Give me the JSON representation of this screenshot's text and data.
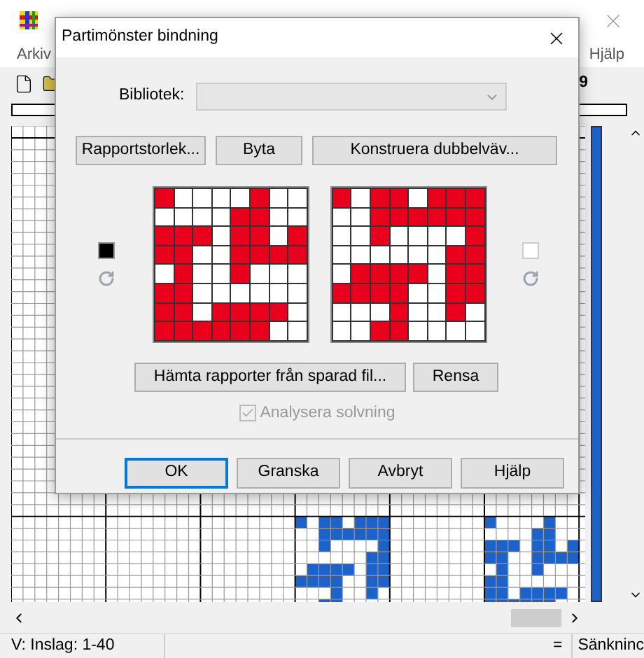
{
  "app": {
    "menu": [
      "Arkiv",
      "Hjälp"
    ],
    "toolbar_text": "9",
    "status_bar": [
      "V: Inslag: 1-40",
      "=",
      "Sänkninc"
    ]
  },
  "dialog": {
    "title": "Partimönster bindning",
    "library": {
      "label": "Bibliotek:",
      "disabled": true
    },
    "top_buttons": [
      "Rapportstorlek...",
      "Byta",
      "Konstruera dubbelväv..."
    ],
    "left_swatch": {
      "color": "#000000"
    },
    "right_swatch": {
      "color": "#ffffff"
    },
    "grids": [
      {
        "cells": [
          [
            true,
            false,
            false,
            false,
            false,
            true,
            false,
            false
          ],
          [
            false,
            false,
            false,
            false,
            true,
            true,
            false,
            false
          ],
          [
            true,
            true,
            true,
            false,
            true,
            true,
            false,
            true
          ],
          [
            true,
            true,
            false,
            false,
            true,
            true,
            true,
            true
          ],
          [
            false,
            true,
            false,
            false,
            true,
            false,
            false,
            false
          ],
          [
            true,
            true,
            false,
            false,
            false,
            false,
            false,
            false
          ],
          [
            true,
            true,
            false,
            true,
            true,
            true,
            true,
            false
          ],
          [
            true,
            true,
            true,
            true,
            true,
            true,
            false,
            false
          ]
        ]
      },
      {
        "cells": [
          [
            true,
            false,
            true,
            true,
            false,
            true,
            true,
            true
          ],
          [
            false,
            false,
            true,
            true,
            true,
            true,
            true,
            true
          ],
          [
            false,
            false,
            true,
            false,
            false,
            false,
            false,
            true
          ],
          [
            false,
            false,
            false,
            false,
            false,
            false,
            true,
            true
          ],
          [
            false,
            true,
            true,
            true,
            true,
            false,
            true,
            true
          ],
          [
            true,
            true,
            true,
            true,
            false,
            false,
            true,
            true
          ],
          [
            false,
            false,
            false,
            true,
            false,
            false,
            true,
            false
          ],
          [
            false,
            false,
            true,
            true,
            false,
            false,
            false,
            false
          ]
        ]
      }
    ],
    "middle_buttons": [
      "Hämta rapporter från sparad fil...",
      "Rensa"
    ],
    "analyse": {
      "label": "Analysera solvning",
      "checked": true,
      "disabled": true
    },
    "bottom_buttons": [
      {
        "label": "OK",
        "selected": true
      },
      {
        "label": "Granska",
        "selected": false
      },
      {
        "label": "Avbryt",
        "selected": false
      },
      {
        "label": "Hjälp",
        "selected": false
      }
    ]
  }
}
